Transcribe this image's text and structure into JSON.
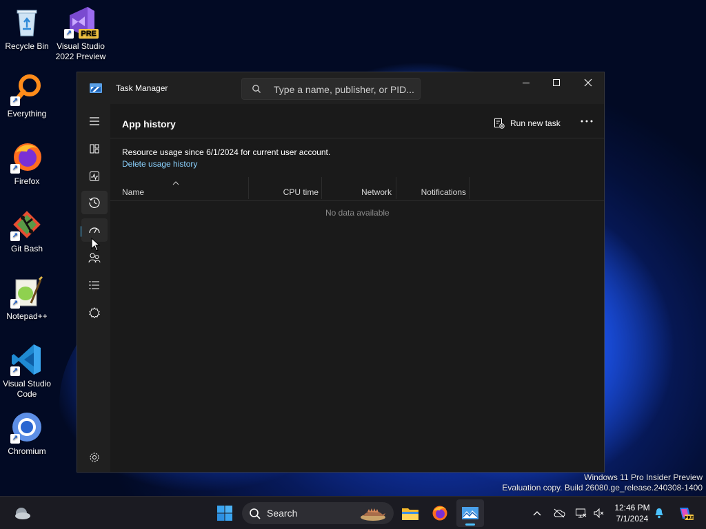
{
  "desktop": {
    "icons": [
      {
        "label": "Recycle Bin",
        "icon": "recycle-bin-icon"
      },
      {
        "label": "Visual Studio 2022 Preview",
        "icon": "visual-studio-icon",
        "badge": "PRE"
      },
      {
        "label": "Everything",
        "icon": "everything-search-icon"
      },
      {
        "label": "Firefox",
        "icon": "firefox-icon"
      },
      {
        "label": "Git Bash",
        "icon": "git-bash-icon"
      },
      {
        "label": "Notepad++",
        "icon": "notepad-plus-plus-icon"
      },
      {
        "label": "Visual Studio Code",
        "icon": "vscode-icon"
      },
      {
        "label": "Chromium",
        "icon": "chromium-icon"
      }
    ],
    "watermark": {
      "line1": "Windows 11 Pro Insider Preview",
      "line2": "Evaluation copy. Build 26080.ge_release.240308-1400"
    }
  },
  "task_manager": {
    "title": "Task Manager",
    "search_placeholder": "Type a name, publisher, or PID...",
    "page_title": "App history",
    "run_new_task_label": "Run new task",
    "info_text": "Resource usage since 6/1/2024 for current user account.",
    "delete_link": "Delete usage history",
    "columns": [
      "Name",
      "CPU time",
      "Network",
      "Notifications"
    ],
    "empty_text": "No data available",
    "nav": [
      {
        "name": "menu",
        "icon": "hamburger-icon"
      },
      {
        "name": "processes",
        "icon": "processes-icon"
      },
      {
        "name": "performance",
        "icon": "performance-icon"
      },
      {
        "name": "app-history",
        "icon": "history-icon",
        "active": true
      },
      {
        "name": "startup-apps",
        "icon": "startup-icon"
      },
      {
        "name": "users",
        "icon": "users-icon"
      },
      {
        "name": "details",
        "icon": "details-icon"
      },
      {
        "name": "services",
        "icon": "services-icon"
      },
      {
        "name": "settings",
        "icon": "settings-icon"
      }
    ],
    "accent_color": "#4cc2ff"
  },
  "taskbar": {
    "search_label": "Search",
    "clock": {
      "time": "12:46 PM",
      "date": "7/1/2024"
    },
    "pinned": [
      "start",
      "search",
      "file-explorer",
      "firefox",
      "task-manager"
    ]
  }
}
